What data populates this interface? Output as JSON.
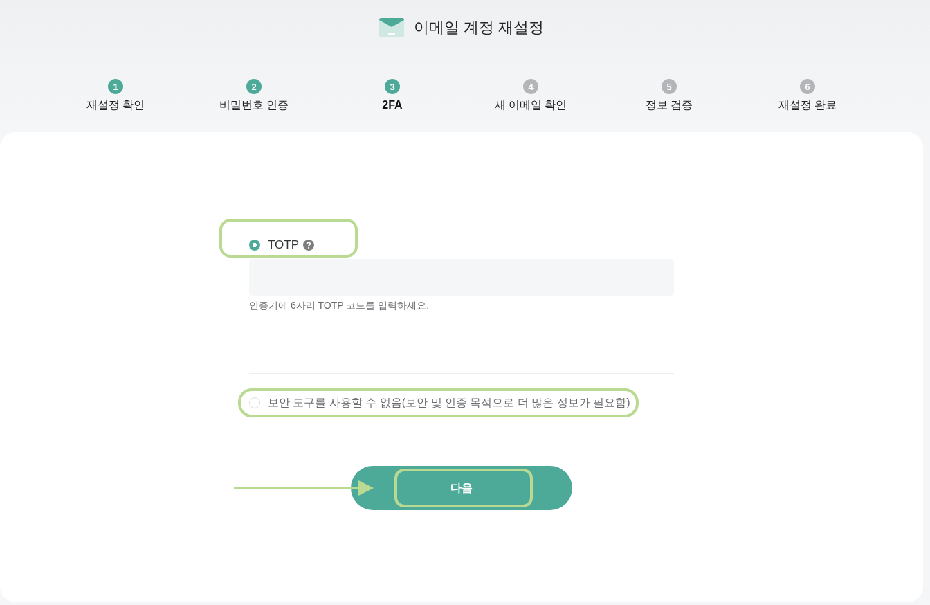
{
  "header": {
    "title": "이메일 계정 재설정"
  },
  "steps": [
    {
      "number": "1",
      "label": "재설정 확인",
      "active": true,
      "selected": false
    },
    {
      "number": "2",
      "label": "비밀번호 인증",
      "active": true,
      "selected": false
    },
    {
      "number": "3",
      "label": "2FA",
      "active": true,
      "selected": true
    },
    {
      "number": "4",
      "label": "새 이메일 확인",
      "active": false,
      "selected": false
    },
    {
      "number": "5",
      "label": "정보 검증",
      "active": false,
      "selected": false
    },
    {
      "number": "6",
      "label": "재설정 완료",
      "active": false,
      "selected": false
    }
  ],
  "form": {
    "options": [
      {
        "kind": "code",
        "label": "TOTP",
        "selected": true,
        "help": true,
        "highlighted": true,
        "hint": "인증기에 6자리 TOTP 코드를 입력하세요."
      },
      {
        "kind": "plain",
        "label": "보안 도구를 사용할 수 없음(보안 및 인증 목적으로 더 많은 정보가 필요함)",
        "selected": false,
        "highlighted": true
      }
    ]
  },
  "next_button": {
    "label": "다음",
    "highlighted": true,
    "pointer_arrow": true
  }
}
